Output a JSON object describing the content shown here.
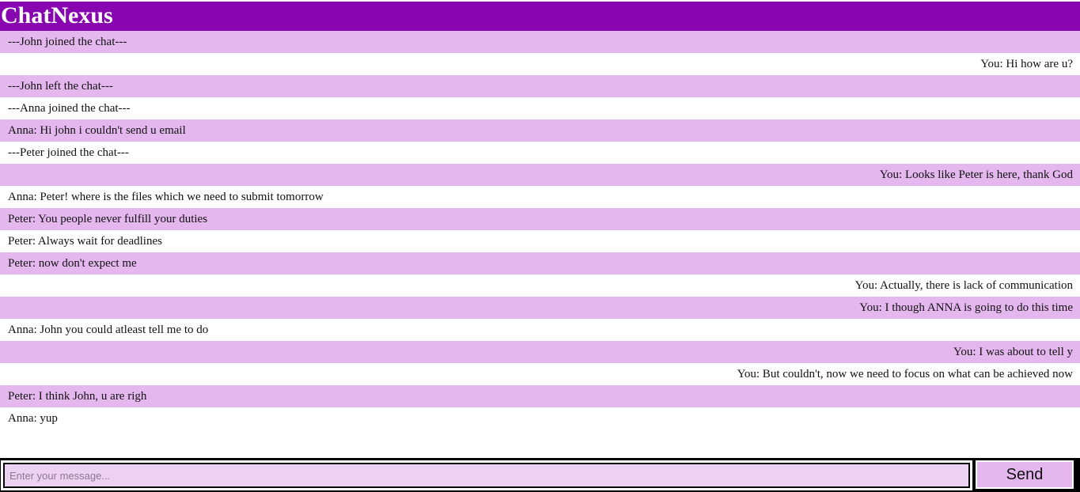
{
  "app": {
    "title": "ChatNexus"
  },
  "colors": {
    "header": "#8806b0",
    "row_alt": "#e4b8ee",
    "row_plain": "#ffffff",
    "input_bg": "#ecd1f3",
    "footer": "#000000"
  },
  "messages": [
    {
      "text": "---John joined the chat---",
      "align": "left"
    },
    {
      "text": "You: Hi how are u?",
      "align": "right"
    },
    {
      "text": "---John left the chat---",
      "align": "left"
    },
    {
      "text": "---Anna joined the chat---",
      "align": "left"
    },
    {
      "text": "Anna: Hi john i couldn't send u email",
      "align": "left"
    },
    {
      "text": "---Peter joined the chat---",
      "align": "left"
    },
    {
      "text": "You: Looks like Peter is here, thank God",
      "align": "right"
    },
    {
      "text": "Anna: Peter! where is the files which we need to submit tomorrow",
      "align": "left"
    },
    {
      "text": "Peter: You people never fulfill your duties",
      "align": "left"
    },
    {
      "text": "Peter: Always wait for deadlines",
      "align": "left"
    },
    {
      "text": "Peter: now don't expect me",
      "align": "left"
    },
    {
      "text": "You: Actually, there is lack of communication",
      "align": "right"
    },
    {
      "text": "You: I though ANNA is going to do this time",
      "align": "right"
    },
    {
      "text": "Anna: John you could atleast tell me to do",
      "align": "left"
    },
    {
      "text": "You: I was about to tell y",
      "align": "right"
    },
    {
      "text": "You: But couldn't, now we need to focus on what can be achieved now",
      "align": "right"
    },
    {
      "text": "Peter: I think John, u are righ",
      "align": "left"
    },
    {
      "text": "Anna: yup",
      "align": "left"
    }
  ],
  "compose": {
    "value": "",
    "placeholder": "Enter your message...",
    "send_label": "Send"
  }
}
